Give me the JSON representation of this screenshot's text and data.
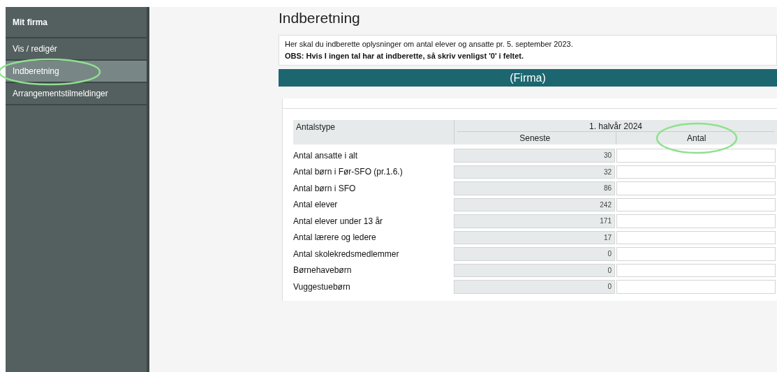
{
  "sidebar": {
    "title": "Mit firma",
    "items": [
      {
        "label": "Vis / redigér",
        "selected": false,
        "highlighted": false
      },
      {
        "label": "Indberetning",
        "selected": true,
        "highlighted": true
      },
      {
        "label": "Arrangementstilmeldinger",
        "selected": false,
        "highlighted": false
      }
    ]
  },
  "page": {
    "title": "Indberetning"
  },
  "info": {
    "text": "Her skal du indberette oplysninger om antal elever og ansatte pr. 5. september 2023.",
    "notice": "OBS: Hvis I ingen tal har at indberette, så skriv venligst '0' i feltet."
  },
  "banner": "(Firma)",
  "table": {
    "columns": [
      {
        "label": "Antalstype",
        "highlighted": false
      },
      {
        "label": "Seneste",
        "highlighted": false
      },
      {
        "label": "Antal",
        "highlighted": true
      }
    ],
    "group": "1. halvår 2024",
    "rows": [
      {
        "label": "Antal ansatte i alt",
        "latest": "30"
      },
      {
        "label": "Antal børn i Før-SFO (pr.1.6.)",
        "latest": "32"
      },
      {
        "label": "Antal børn i SFO",
        "latest": "86"
      },
      {
        "label": "Antal elever",
        "latest": "242"
      },
      {
        "label": "Antal elever under 13 år",
        "latest": "171"
      },
      {
        "label": "Antal lærere og ledere",
        "latest": "17"
      },
      {
        "label": "Antal skolekredsmedlemmer",
        "latest": "0"
      },
      {
        "label": "Børnehavebørn",
        "latest": "0"
      },
      {
        "label": "Vuggestuebørn",
        "latest": "0"
      }
    ]
  }
}
